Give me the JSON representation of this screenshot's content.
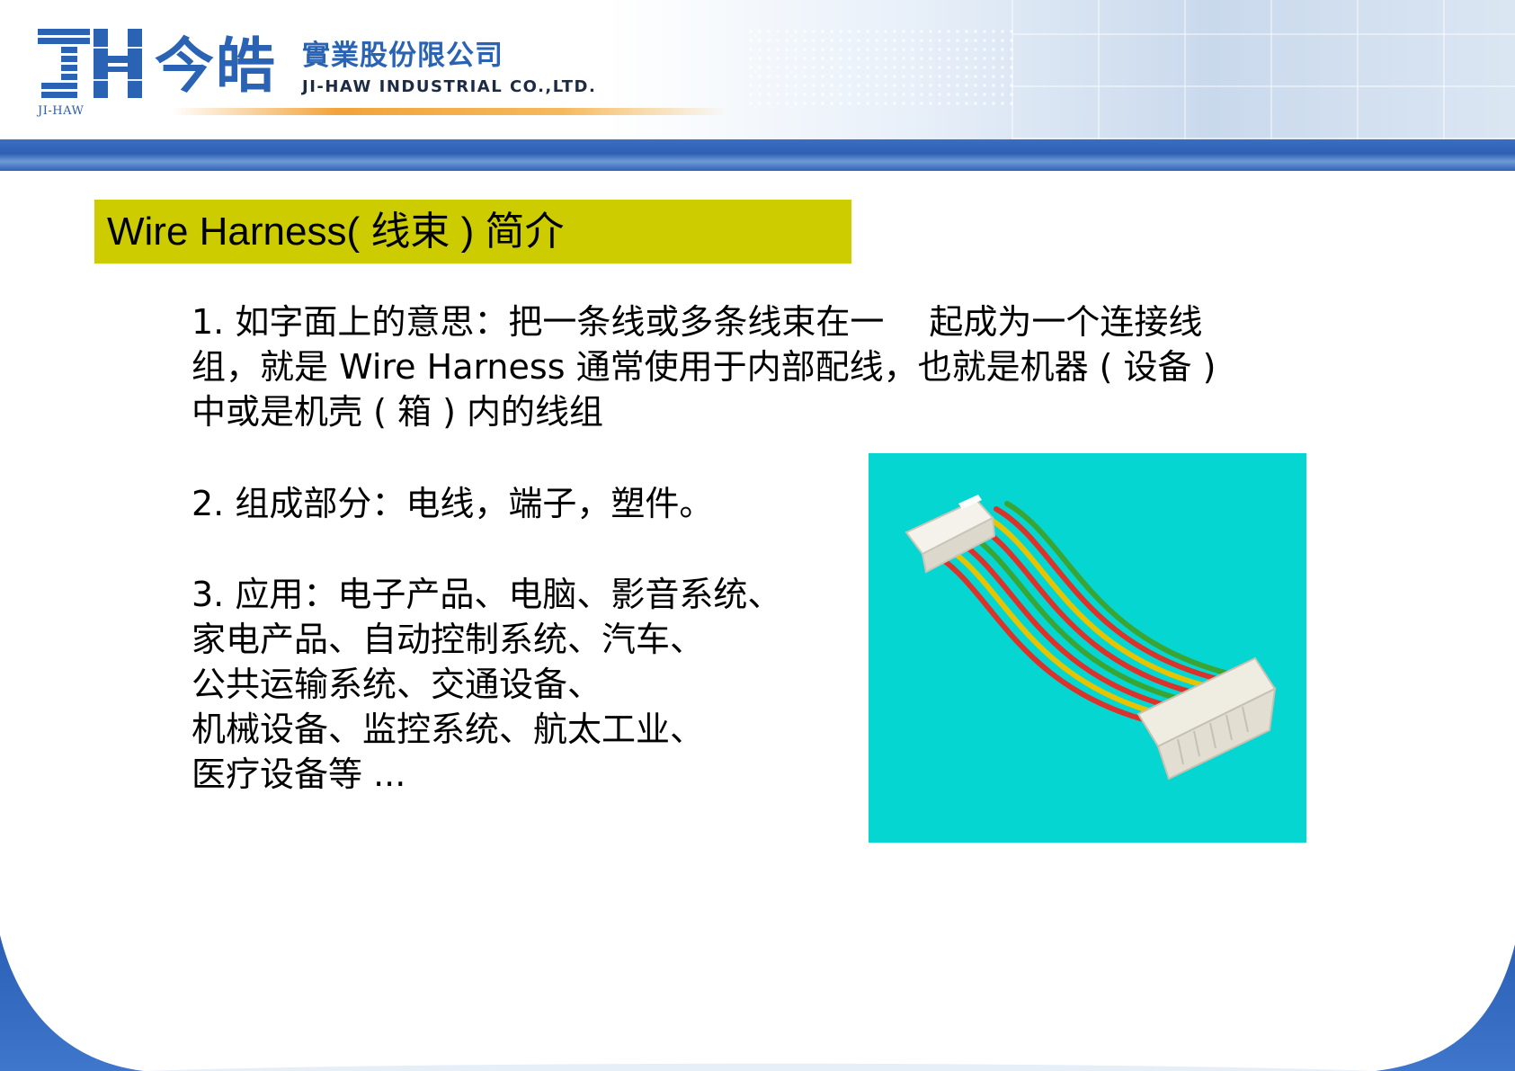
{
  "header": {
    "logo_sub": "JI-HAW",
    "logo_cn": "今皓",
    "company_cn": "實業股份限公司",
    "company_en": "JI-HAW INDUSTRIAL CO.,LTD.",
    "colors": {
      "brand_blue": "#2a63b4",
      "band_blue": "#2e5fb3",
      "accent_orange": "#f2a33a"
    }
  },
  "slide": {
    "title": "Wire Harness( 线束 ) 简介",
    "title_bg": "#cccc00",
    "p1": {
      "line1": "1. 如字面上的意思：把一条线或多条线束在一　  起成为一个连接线",
      "line2": "组，就是 Wire Harness 通常使用于内部配线，也就是机器 ( 设备 )",
      "line3": "中或是机壳 ( 箱 ) 内的线组"
    },
    "p2": "2. 组成部分：电线，端子，塑件。",
    "p3": {
      "line1": "3. 应用：电子产品、电脑、影音系统、",
      "line2": "家电产品、自动控制系统、汽车、",
      "line3": "公共运输系统、交通设备、",
      "line4": "机械设备、监控系统、航太工业、",
      "line5": "医疗设备等 ..."
    },
    "photo_bg": "#05d6d1"
  }
}
